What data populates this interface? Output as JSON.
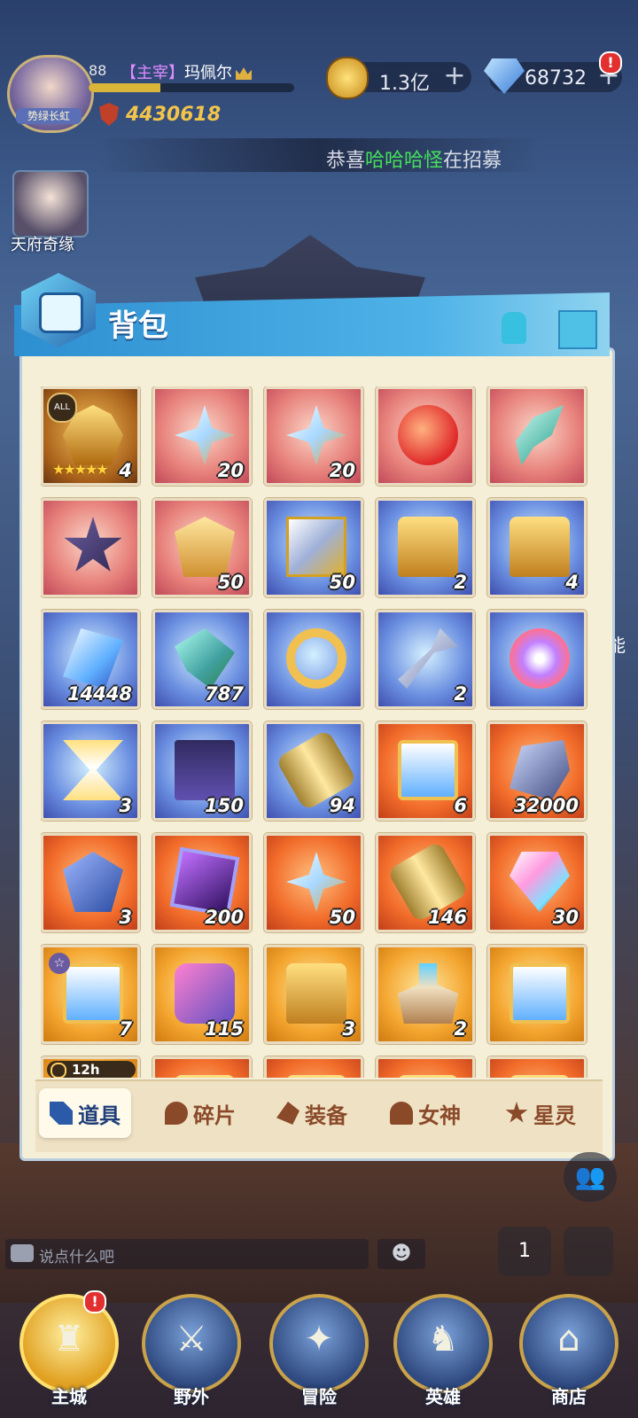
{
  "player": {
    "level": "88",
    "title": "【主宰】",
    "name": "玛佩尔",
    "avatar_banner": "势绿长虹",
    "power": "4430618",
    "xp_progress": 0.35
  },
  "resources": {
    "gold": "1.3亿",
    "gems": "68732",
    "alert": "!"
  },
  "announcement": {
    "prefix": "恭喜",
    "highlight": "哈哈哈怪",
    "suffix": "在招募"
  },
  "side_event": {
    "label": "天府奇缘"
  },
  "bag": {
    "title": "背包",
    "items": [
      {
        "art": "mask",
        "rarity": "gold",
        "qty": "4",
        "stars": "★★★★★",
        "badge": "ALL"
      },
      {
        "art": "star",
        "rarity": "red",
        "qty": "20"
      },
      {
        "art": "star",
        "rarity": "red",
        "qty": "20"
      },
      {
        "art": "fruit",
        "rarity": "red",
        "qty": ""
      },
      {
        "art": "blade",
        "rarity": "red",
        "qty": ""
      },
      {
        "art": "hex",
        "rarity": "red",
        "qty": ""
      },
      {
        "art": "armor",
        "rarity": "red",
        "qty": "50"
      },
      {
        "art": "cube",
        "rarity": "blue",
        "qty": "50"
      },
      {
        "art": "chest",
        "rarity": "blue",
        "qty": "2"
      },
      {
        "art": "chest",
        "rarity": "blue",
        "qty": "4"
      },
      {
        "art": "crystal",
        "rarity": "blue",
        "qty": "14448"
      },
      {
        "art": "leaf",
        "rarity": "blue",
        "qty": "787"
      },
      {
        "art": "ring",
        "rarity": "blue",
        "qty": ""
      },
      {
        "art": "key",
        "rarity": "blue",
        "qty": "2"
      },
      {
        "art": "swirl",
        "rarity": "blue",
        "qty": ""
      },
      {
        "art": "hourglass",
        "rarity": "blue",
        "qty": "3"
      },
      {
        "art": "scroll",
        "rarity": "blue",
        "qty": "150"
      },
      {
        "art": "cyl",
        "rarity": "blue",
        "qty": "94"
      },
      {
        "art": "card",
        "rarity": "orange",
        "qty": "6"
      },
      {
        "art": "rock",
        "rarity": "orange",
        "qty": "32000"
      },
      {
        "art": "rune",
        "rarity": "orange",
        "qty": "3"
      },
      {
        "art": "box",
        "rarity": "orange",
        "qty": "200"
      },
      {
        "art": "star",
        "rarity": "orange",
        "qty": "50"
      },
      {
        "art": "cyl",
        "rarity": "orange",
        "qty": "146"
      },
      {
        "art": "gem",
        "rarity": "orange",
        "qty": "30"
      },
      {
        "art": "card",
        "rarity": "yellow",
        "qty": "7",
        "badge_star": "☆"
      },
      {
        "art": "puzzle",
        "rarity": "yellow",
        "qty": "115"
      },
      {
        "art": "chest",
        "rarity": "yellow",
        "qty": "3"
      },
      {
        "art": "altar",
        "rarity": "yellow",
        "qty": "2"
      },
      {
        "art": "card",
        "rarity": "yellow",
        "qty": ""
      },
      {
        "art": "chest",
        "rarity": "yellow",
        "qty": "",
        "timer": "12h"
      },
      {
        "art": "chest",
        "rarity": "orange",
        "qty": ""
      },
      {
        "art": "chest",
        "rarity": "orange",
        "qty": ""
      },
      {
        "art": "chest",
        "rarity": "orange",
        "qty": ""
      },
      {
        "art": "chest",
        "rarity": "orange",
        "qty": ""
      }
    ]
  },
  "tabs": [
    {
      "label": "道具",
      "icon": "props-icon",
      "active": true
    },
    {
      "label": "碎片",
      "icon": "fragment-icon",
      "active": false
    },
    {
      "label": "装备",
      "icon": "equipment-icon",
      "active": false
    },
    {
      "label": "女神",
      "icon": "goddess-icon",
      "active": false
    },
    {
      "label": "星灵",
      "icon": "star-spirit-icon",
      "active": false
    }
  ],
  "chat": {
    "placeholder": "说点什么吧",
    "emoji": "☻"
  },
  "side_label": "能",
  "rank_label": "1",
  "nav": [
    {
      "label": "主城",
      "icon": "castle-icon",
      "active": true,
      "alert": "!"
    },
    {
      "label": "野外",
      "icon": "wild-icon"
    },
    {
      "label": "冒险",
      "icon": "adventure-icon"
    },
    {
      "label": "英雄",
      "icon": "hero-icon"
    },
    {
      "label": "商店",
      "icon": "shop-icon"
    }
  ],
  "colors": {
    "accent": "#2d8fd0",
    "panel_bg": "#f6efd8",
    "power_gold": "#f2c54a",
    "highlight_green": "#45e05a"
  }
}
